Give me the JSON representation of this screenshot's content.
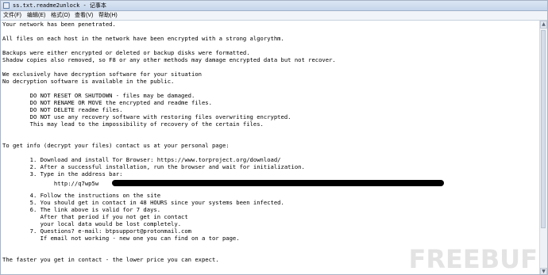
{
  "window": {
    "title": "ss.txt.readme2unlock - 记事本"
  },
  "menubar": {
    "items": [
      "文件(F)",
      "编辑(E)",
      "格式(O)",
      "查看(V)",
      "帮助(H)"
    ]
  },
  "document": {
    "lines": [
      "Your network has been penetrated.",
      "",
      "All files on each host in the network have been encrypted with a strong algorythm.",
      "",
      "Backups were either encrypted or deleted or backup disks were formatted.",
      "Shadow copies also removed, so F8 or any other methods may damage encrypted data but not recover.",
      "",
      "We exclusively have decryption software for your situation",
      "No decryption software is available in the public.",
      "",
      "        DO NOT RESET OR SHUTDOWN - files may be damaged.",
      "        DO NOT RENAME OR MOVE the encrypted and readme files.",
      "        DO NOT DELETE readme files.",
      "        DO NOT use any recovery software with restoring files overwriting encrypted.",
      "        This may lead to the impossibility of recovery of the certain files.",
      "",
      "",
      "To get info (decrypt your files) contact us at your personal page:",
      "",
      "        1. Download and install Tor Browser: https://www.torproject.org/download/",
      "        2. After a successful installation, run the browser and wait for initialization.",
      "        3. Type in the address bar:",
      "",
      "               http://q7wp5w",
      "",
      "        4. Follow the instructions on the site",
      "        5. You should get in contact in 48 HOURS since your systems been infected.",
      "        6. The link above is valid for 7 days.",
      "           After that period if you not get in contact",
      "           your local data would be lost completely.",
      "        7. Questions? e-mail: btpsupport@protonmail.com",
      "           If email not working - new one you can find on a tor page.",
      "",
      "",
      "The faster you get in contact - the lower price you can expect."
    ]
  },
  "watermark": "FREEBUF"
}
